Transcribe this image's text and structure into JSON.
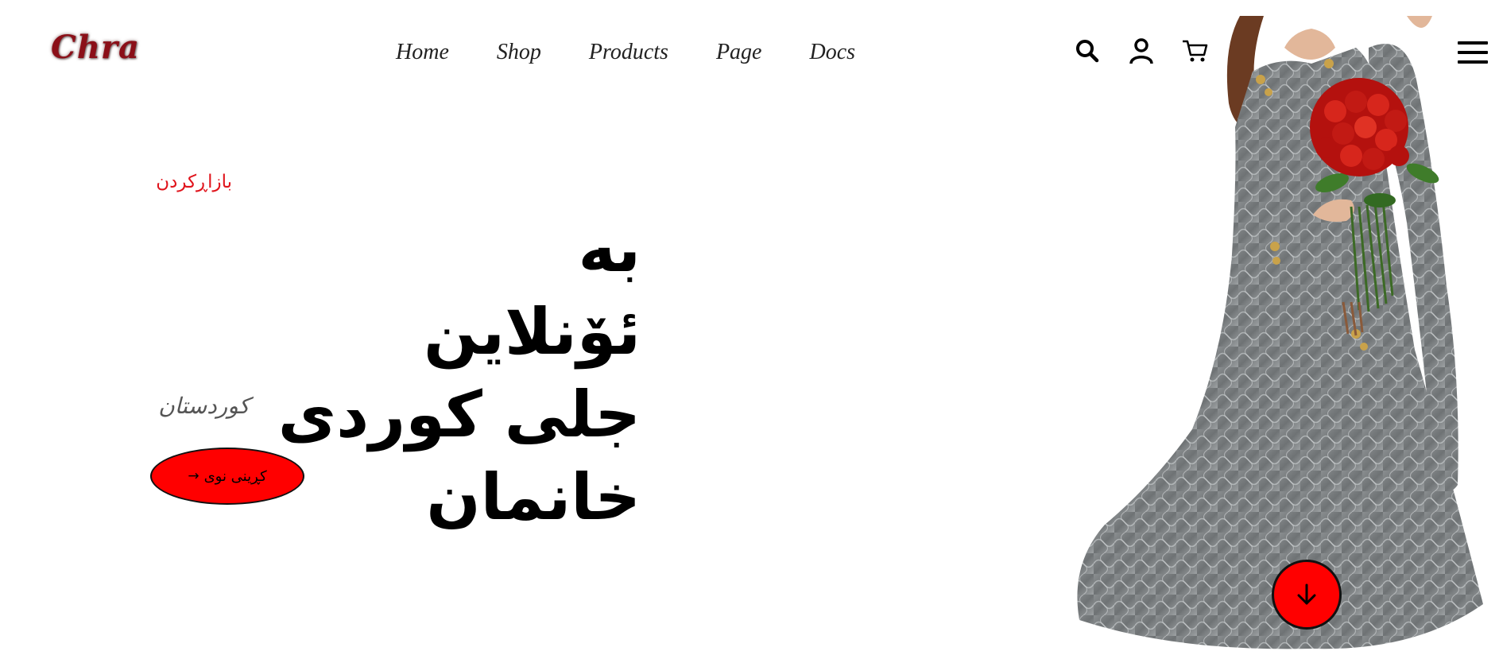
{
  "header": {
    "logo": "Chra",
    "nav": [
      "Home",
      "Shop",
      "Products",
      "Page",
      "Docs"
    ],
    "icons": [
      "search-icon",
      "user-icon",
      "cart-icon",
      "menu-icon"
    ]
  },
  "hero": {
    "eyebrow": "بازاڕکردن",
    "headline_line1": "به ئۆنلاین",
    "headline_line2": "جلی کوردی خانمان",
    "subtitle": "کوردستان",
    "cta_label": "کڕینی نوی",
    "cta_arrow": "→"
  },
  "colors": {
    "accent": "#ff0000",
    "logo": "#8b0f18",
    "eyebrow": "#e0131b"
  }
}
